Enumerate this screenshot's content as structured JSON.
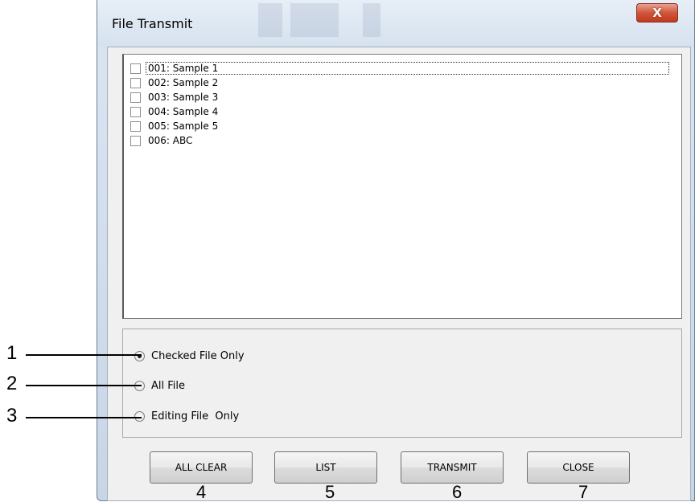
{
  "window": {
    "title": "File Transmit",
    "close_glyph": "X"
  },
  "file_list": [
    {
      "label": "001: Sample 1",
      "checked": false,
      "focused": true
    },
    {
      "label": "002: Sample 2",
      "checked": false,
      "focused": false
    },
    {
      "label": "003: Sample 3",
      "checked": false,
      "focused": false
    },
    {
      "label": "004: Sample 4",
      "checked": false,
      "focused": false
    },
    {
      "label": "005: Sample 5",
      "checked": false,
      "focused": false
    },
    {
      "label": "006: ABC",
      "checked": false,
      "focused": false
    }
  ],
  "transmit_options": [
    {
      "label": "Checked File Only",
      "selected": true
    },
    {
      "label": "All File",
      "selected": false
    },
    {
      "label": "Editing File  Only",
      "selected": false
    }
  ],
  "buttons": {
    "all_clear": "ALL CLEAR",
    "list": "LIST",
    "transmit": "TRANSMIT",
    "close": "CLOSE"
  },
  "callouts": {
    "radio": [
      "1",
      "2",
      "3"
    ],
    "buttons": [
      "4",
      "5",
      "6",
      "7"
    ]
  }
}
